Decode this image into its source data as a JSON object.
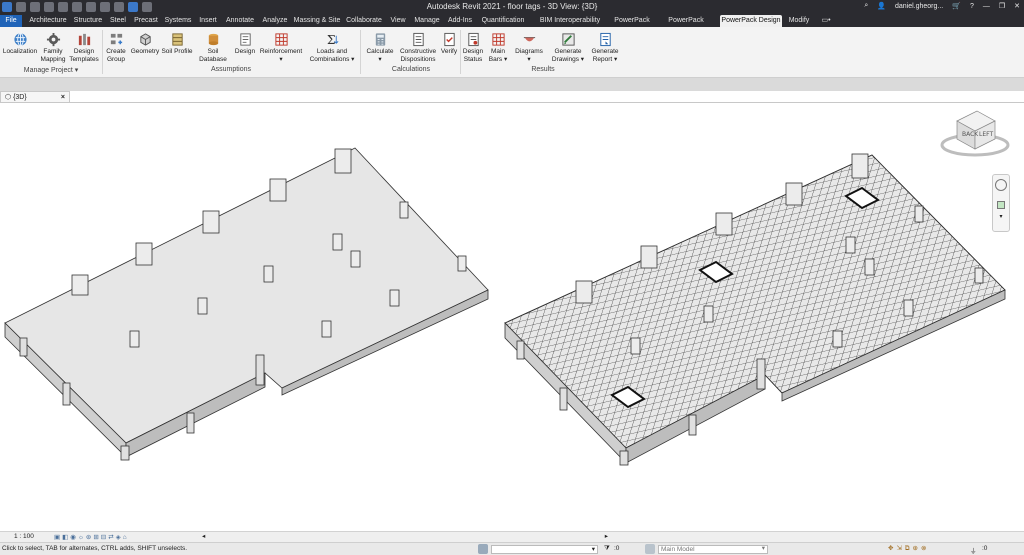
{
  "window": {
    "title": "Autodesk Revit 2021 - floor tags - 3D View: {3D}",
    "user": "daniel.gheorg...",
    "help_icon": "?"
  },
  "tabs": [
    {
      "label": "File"
    },
    {
      "label": "Architecture"
    },
    {
      "label": "Structure"
    },
    {
      "label": "Steel"
    },
    {
      "label": "Precast"
    },
    {
      "label": "Systems"
    },
    {
      "label": "Insert"
    },
    {
      "label": "Annotate"
    },
    {
      "label": "Analyze"
    },
    {
      "label": "Massing & Site"
    },
    {
      "label": "Collaborate"
    },
    {
      "label": "View"
    },
    {
      "label": "Manage"
    },
    {
      "label": "Add-Ins"
    },
    {
      "label": "Quantification"
    },
    {
      "label": "BIM Interoperability Tools"
    },
    {
      "label": "PowerPack"
    },
    {
      "label": "PowerPack Detailing"
    },
    {
      "label": "PowerPack Design"
    },
    {
      "label": "Modify"
    }
  ],
  "ribbon": {
    "buttons": [
      {
        "label": "Localization",
        "icon": "globe-icon"
      },
      {
        "label": "Family Mapping",
        "icon": "family-mapping-icon"
      },
      {
        "label": "Design Templates",
        "icon": "design-templates-icon"
      },
      {
        "label": "Create Group",
        "icon": "create-group-icon"
      },
      {
        "label": "Geometry",
        "icon": "geometry-icon"
      },
      {
        "label": "Soil Profile",
        "icon": "soil-profile-icon"
      },
      {
        "label": "Soil Database",
        "icon": "soil-database-icon"
      },
      {
        "label": "Design",
        "icon": "design-icon"
      },
      {
        "label": "Reinforcement",
        "icon": "reinforcement-icon"
      },
      {
        "label": "Loads and Combinations",
        "icon": "sigma-icon"
      },
      {
        "label": "Calculate",
        "icon": "calculator-icon"
      },
      {
        "label": "Constructive Dispositions",
        "icon": "checklist-icon"
      },
      {
        "label": "Verify",
        "icon": "verify-icon"
      },
      {
        "label": "Design Status",
        "icon": "design-status-icon"
      },
      {
        "label": "Main Bars",
        "icon": "main-bars-icon"
      },
      {
        "label": "Diagrams",
        "icon": "diagrams-icon"
      },
      {
        "label": "Generate Drawings",
        "icon": "generate-drawings-icon"
      },
      {
        "label": "Generate Report",
        "icon": "generate-report-icon"
      }
    ],
    "groups": {
      "manage_project": "Manage Project",
      "assumptions": "Assumptions",
      "calculations": "Calculations",
      "results": "Results"
    }
  },
  "view_tab": {
    "label": "{3D}",
    "close": "×"
  },
  "viewcube": {
    "left_face": "BACK",
    "right_face": "LEFT"
  },
  "status": {
    "scale": "1 : 100",
    "message": "Click to select, TAB for alternates, CTRL adds, SHIFT unselects.",
    "workset_count": ":0",
    "model": "Main Model",
    "filter_count": ":0"
  }
}
